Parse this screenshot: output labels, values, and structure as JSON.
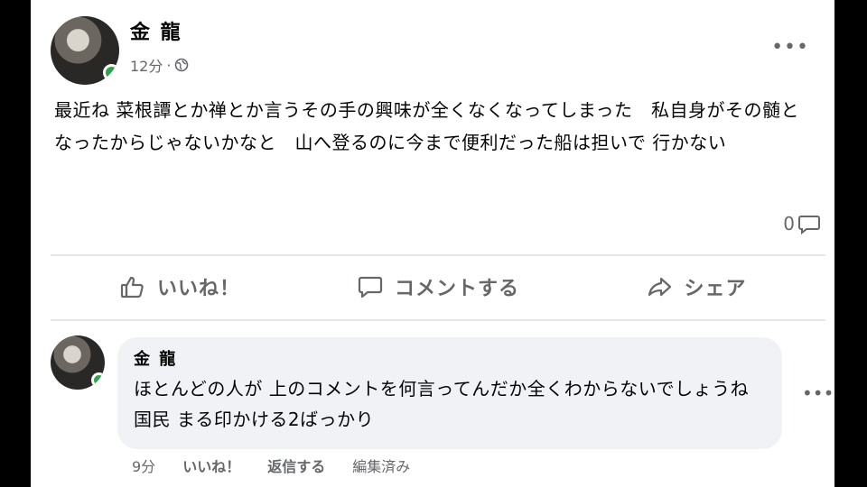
{
  "post": {
    "author": "金 龍",
    "time": "12分",
    "separator": "·",
    "privacy_icon": "globe-icon",
    "more_label": "•••",
    "text": "最近ね 菜根譚とか禅とか言うその手の興味が全くなくなってしまった　私自身がその髄となったからじゃないかなと　山へ登るのに今まで便利だった船は担いで 行かない",
    "comment_count": "0"
  },
  "actions": {
    "like": "いいね！",
    "comment": "コメントする",
    "share": "シェア"
  },
  "comment": {
    "author": "金 龍",
    "text": "ほとんどの人が 上のコメントを何言ってんだか全くわからないでしょうね 国民 まる印かける2ばっかり",
    "more_label": "•••",
    "time": "9分",
    "like": "いいね！",
    "reply": "返信する",
    "edited": "編集済み"
  },
  "colors": {
    "online": "#31a24c",
    "secondary_text": "#65676b",
    "bubble": "#f0f2f5"
  }
}
